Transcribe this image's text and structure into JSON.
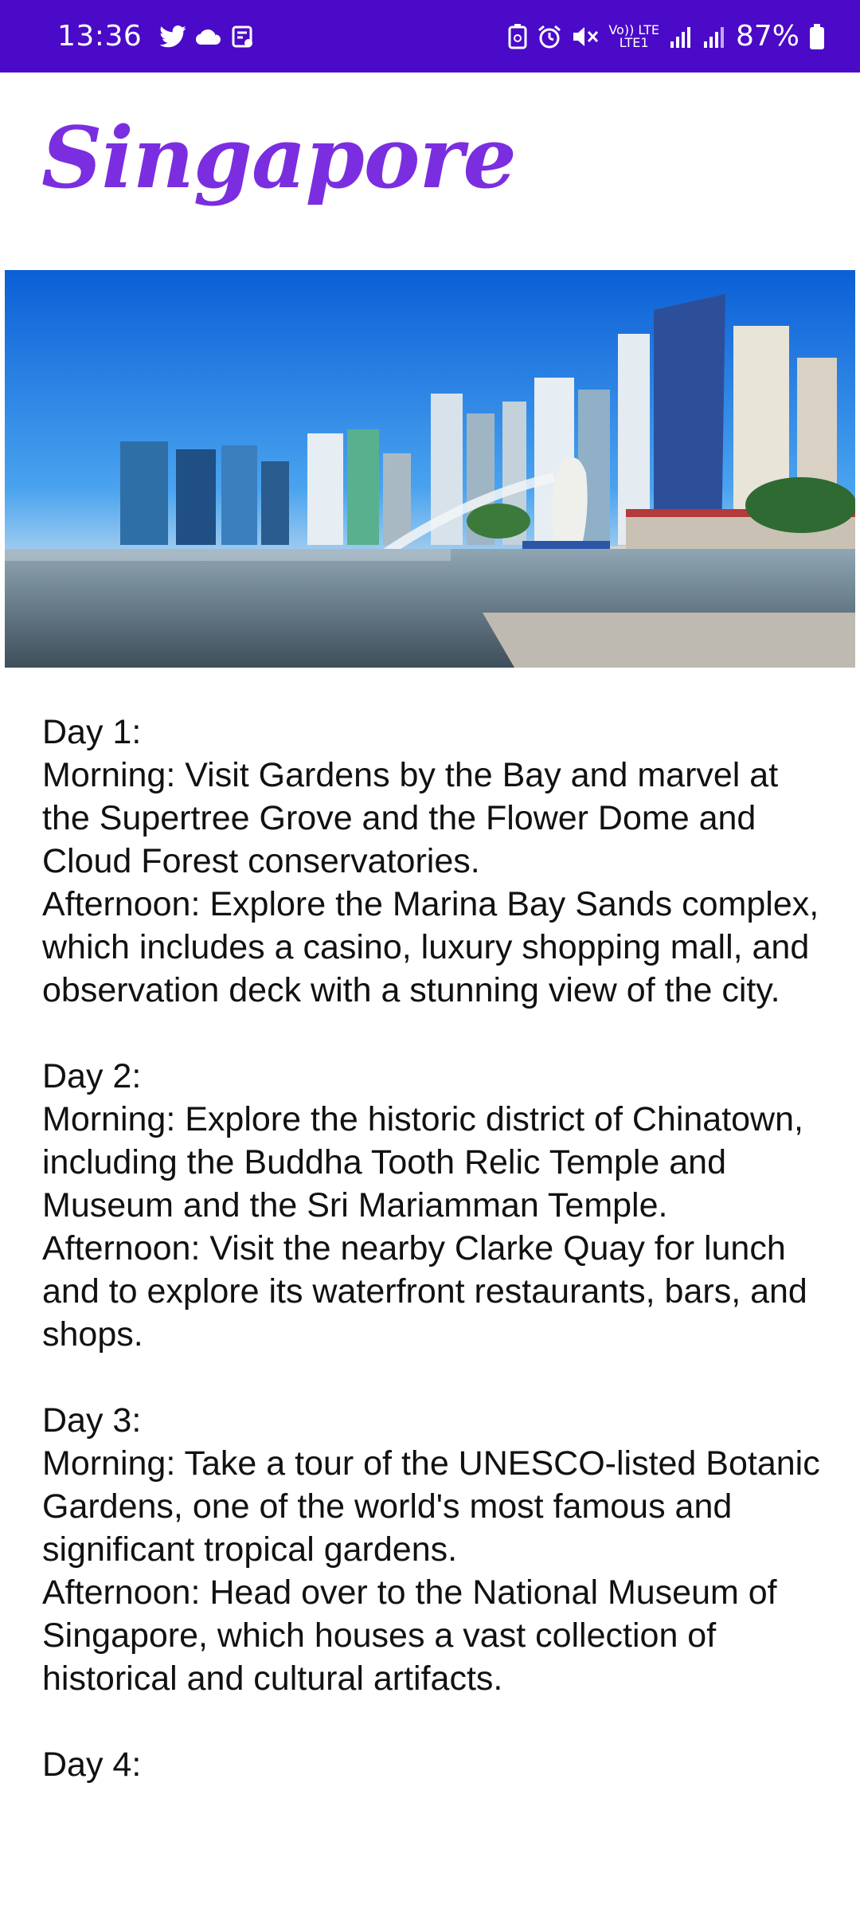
{
  "status_bar": {
    "time": "13:36",
    "net_top": "Vo)) LTE",
    "net_bottom": "LTE1",
    "battery": "87%"
  },
  "page": {
    "title": "Singapore"
  },
  "hero_image": {
    "subject": "marina-bay-merlion-skyline"
  },
  "itinerary": [
    {
      "heading": "Day 1:",
      "morning": "Morning: Visit Gardens by the Bay and marvel at the Supertree Grove and the Flower Dome and Cloud Forest conservatories.",
      "afternoon": "Afternoon: Explore the Marina Bay Sands complex, which includes a casino, luxury shopping mall, and observation deck with a stunning view of the city."
    },
    {
      "heading": "Day 2:",
      "morning": "Morning: Explore the historic district of Chinatown, including the Buddha Tooth Relic Temple and Museum and the Sri Mariamman Temple.",
      "afternoon": "Afternoon: Visit the nearby Clarke Quay for lunch and to explore its waterfront restaurants, bars, and shops."
    },
    {
      "heading": "Day 3:",
      "morning": "Morning: Take a tour of the UNESCO-listed Botanic Gardens, one of the world's most famous and significant tropical gardens.",
      "afternoon": "Afternoon: Head over to the National Museum of Singapore, which houses a vast collection of historical and cultural artifacts."
    },
    {
      "heading": "Day 4:"
    }
  ],
  "colors": {
    "status_bar_bg": "#4a0ac8",
    "title_color": "#7b2ee0",
    "body_text": "#111111"
  }
}
